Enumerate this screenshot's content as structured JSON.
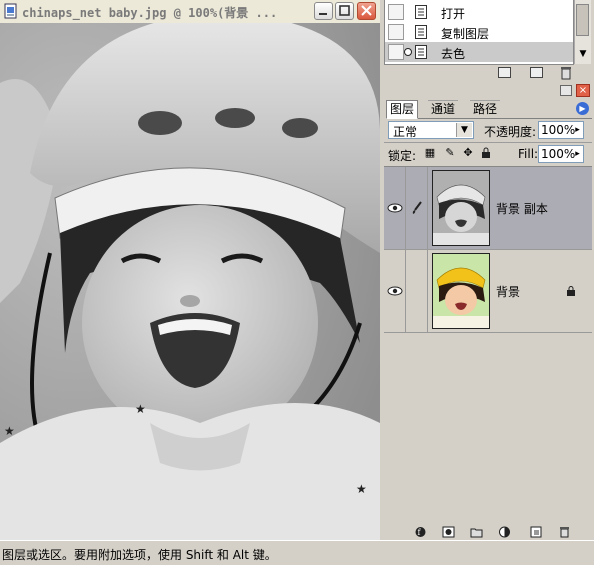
{
  "document": {
    "title": "chinaps_net baby.jpg @ 100%(背景 ..."
  },
  "history": {
    "items": [
      {
        "label": "打开",
        "selected": false
      },
      {
        "label": "复制图层",
        "selected": false
      },
      {
        "label": "去色",
        "selected": true
      }
    ]
  },
  "layers_panel": {
    "tabs": [
      {
        "label": "图层",
        "active": true
      },
      {
        "label": "通道",
        "active": false
      },
      {
        "label": "路径",
        "active": false
      }
    ],
    "blend_mode": "正常",
    "opacity_label": "不透明度:",
    "opacity_value": "100%",
    "lock_label": "锁定:",
    "fill_label": "Fill:",
    "fill_value": "100%",
    "layers": [
      {
        "name": "背景 副本",
        "selected": true,
        "visible": true,
        "thumbnail": "grayscale"
      },
      {
        "name": "背景",
        "selected": false,
        "visible": true,
        "thumbnail": "color",
        "locked": true
      }
    ]
  },
  "status_bar": {
    "text": "图层或选区。要用附加选项，使用 Shift 和 Alt 键。"
  },
  "colors": {
    "panel_bg": "#d4d0c8",
    "selected_row": "#acacb4",
    "close_button": "#e06048",
    "helmet_yellow": "#f2c21a"
  }
}
